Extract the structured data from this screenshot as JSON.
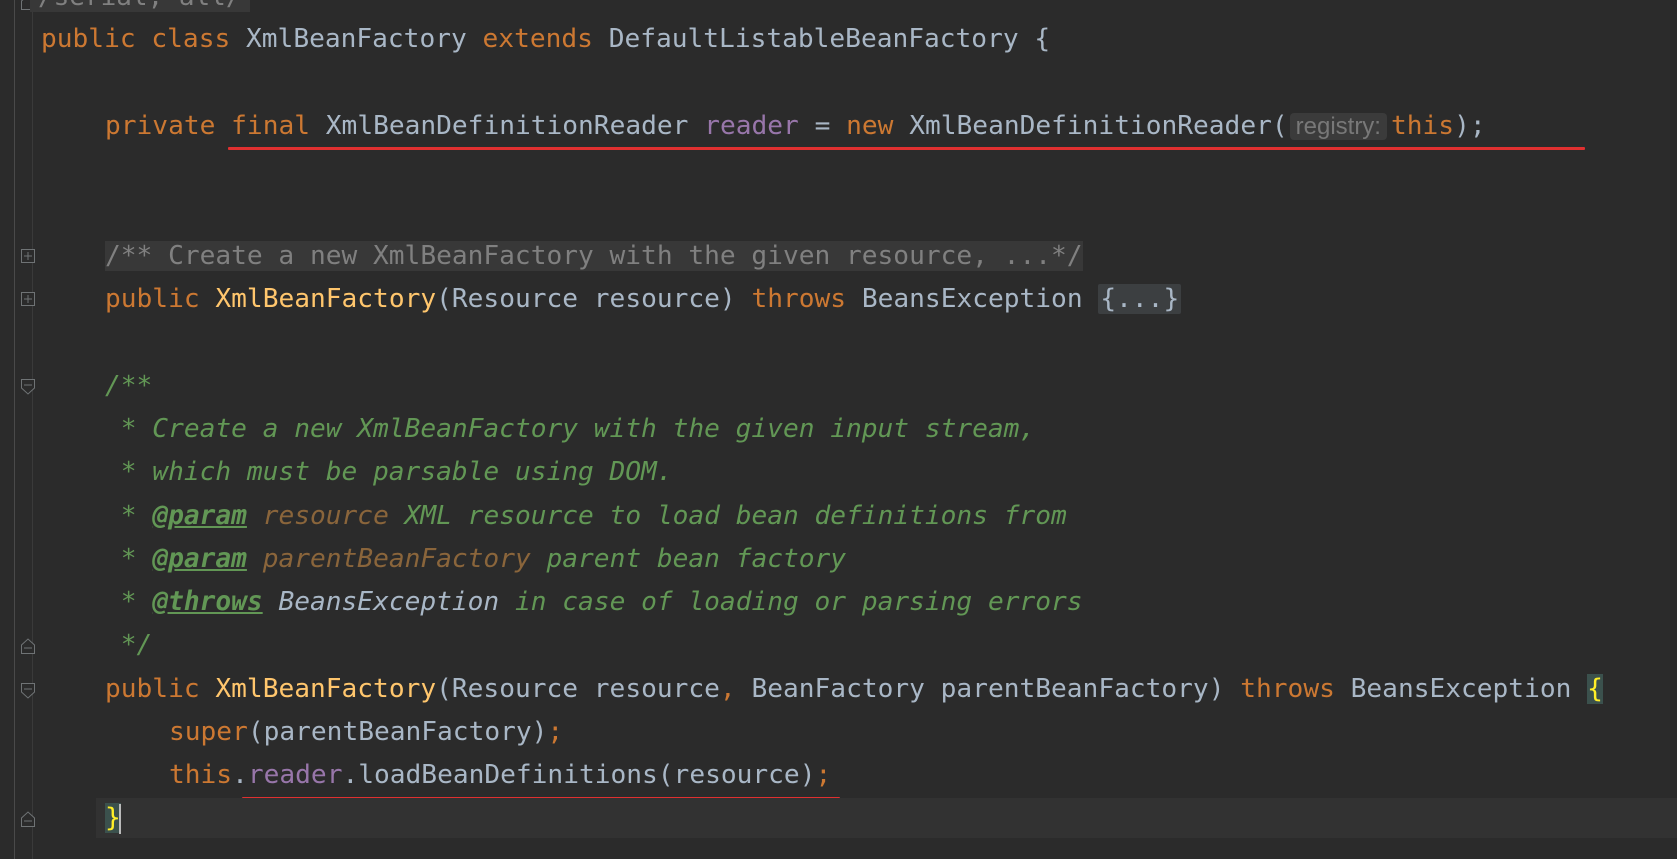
{
  "editor": {
    "top_fragment": "/serial, all/",
    "lines": {
      "class_decl": {
        "kw1": "public",
        "kw2": "class",
        "name": "XmlBeanFactory",
        "kw3": "extends",
        "parent": "DefaultListableBeanFactory",
        "brace": "{"
      },
      "field_decl": {
        "kw1": "private",
        "kw2": "final",
        "type": "XmlBeanDefinitionReader",
        "field": "reader",
        "eq": "=",
        "kw3": "new",
        "ctor": "XmlBeanDefinitionReader(",
        "hint": "registry:",
        "arg": "this",
        "close": ");"
      },
      "folded_comment": "/** Create a new XmlBeanFactory with the given resource, ...*/",
      "ctor1": {
        "kw": "public",
        "name": "XmlBeanFactory",
        "params": "(Resource resource)",
        "kw2": "throws",
        "exc": "BeansException",
        "folded": "{...}"
      },
      "doc_open": "/**",
      "doc_line1": " * Create a new XmlBeanFactory with the given input stream,",
      "doc_line2": " * which must be parsable using DOM.",
      "doc_param1": {
        "star": " * ",
        "tag": "@param",
        "param": "resource",
        "text": " XML resource to load bean definitions from"
      },
      "doc_param2": {
        "star": " * ",
        "tag": "@param",
        "param": "parentBeanFactory",
        "text": " parent bean factory"
      },
      "doc_throws": {
        "star": " * ",
        "tag": "@throws",
        "ref": "BeansException",
        "text": " in case of loading or parsing errors"
      },
      "doc_close": " */",
      "ctor2": {
        "kw": "public",
        "name": "XmlBeanFactory",
        "p1": "(Resource resource",
        "comma": ",",
        "p2": " BeanFactory parentBeanFactory)",
        "kw2": "throws",
        "exc": "BeansException",
        "brace": "{"
      },
      "super_call": {
        "kw": "super",
        "args": "(parentBeanFactory)",
        "semi": ";"
      },
      "load_call": {
        "this": "this",
        "dot1": ".",
        "field": "reader",
        "rest": ".loadBeanDefinitions(resource)",
        "semi": ";"
      },
      "close_brace": "}"
    }
  },
  "colors": {
    "background": "#2b2b2b",
    "keyword": "#cc7832",
    "method": "#ffc66d",
    "field": "#9876aa",
    "doc_comment": "#629755",
    "annotation_underline": "#e03030"
  },
  "icons": [
    "fold-expand-icon",
    "fold-collapse-icon",
    "fold-end-icon"
  ]
}
